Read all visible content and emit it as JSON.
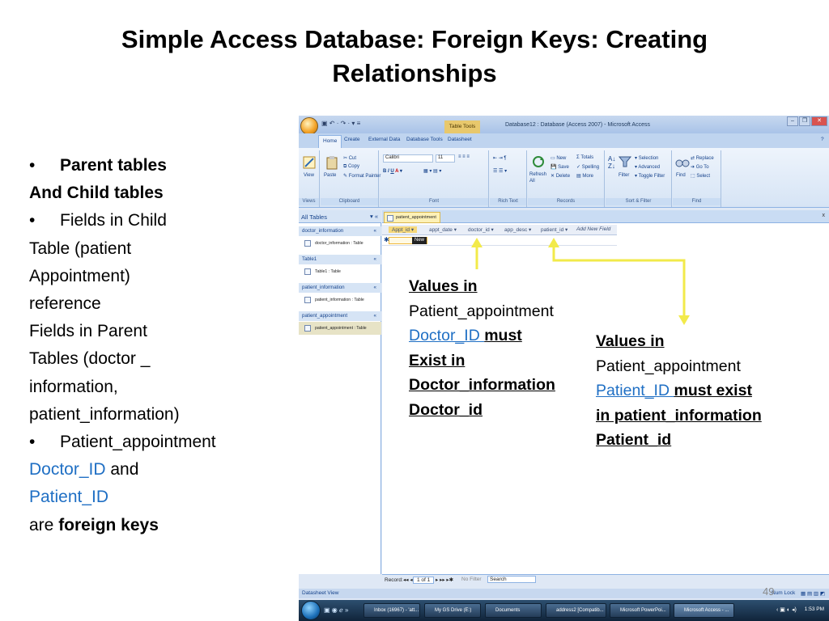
{
  "slide": {
    "title": "Simple Access Database: Foreign Keys: Creating Relationships",
    "left": {
      "bullet1_bold": "Parent tables",
      "line1b_bold": "And Child tables",
      "bullet2": "Fields in Child",
      "line2b": "Table (patient",
      "line2c": "Appointment)",
      "line2d": "reference",
      "line2e": "Fields in Parent",
      "line2f": "Tables (doctor _",
      "line2g": "information,",
      "line2h": "patient_information)",
      "bullet3": "Patient_appointment",
      "doctor_id": "Doctor_ID",
      "and": " and",
      "patient_id": "Patient_ID",
      "are": "are ",
      "foreign_keys": "foreign keys"
    },
    "note1": {
      "heading": "Values in",
      "line2": "Patient_appointment",
      "link": "Doctor_ID ",
      "must": " must",
      "line4": "Exist in",
      "line5": "Doctor_information",
      "line6": "Doctor_id"
    },
    "note2": {
      "heading": "Values in",
      "line2": "Patient_appointment",
      "link": "Patient_ID ",
      "must": " must exist",
      "line4": "in patient_information",
      "line5": "Patient_id"
    },
    "page_number": "49"
  },
  "access": {
    "window_title": "Database12 : Database (Access 2007) - Microsoft Access",
    "context_tab": "Table Tools",
    "tabs": [
      "Home",
      "Create",
      "External Data",
      "Database Tools",
      "Datasheet"
    ],
    "ribbon": {
      "views": {
        "view": "View",
        "label": "Views"
      },
      "clipboard": {
        "paste": "Paste",
        "cut": "Cut",
        "copy": "Copy",
        "format_painter": "Format Painter",
        "label": "Clipboard"
      },
      "font": {
        "family": "Calibri",
        "size": "11",
        "label": "Font"
      },
      "rich_text": {
        "label": "Rich Text"
      },
      "records": {
        "refresh": "Refresh All",
        "new": "New",
        "save": "Save",
        "delete": "Delete",
        "totals": "Totals",
        "spelling": "Spelling",
        "more": "More",
        "label": "Records"
      },
      "sort_filter": {
        "filter": "Filter",
        "selection": "Selection",
        "advanced": "Advanced",
        "toggle_filter": "Toggle Filter",
        "label": "Sort & Filter"
      },
      "find": {
        "find": "Find",
        "replace": "Replace",
        "goto": "Go To",
        "select": "Select",
        "label": "Find"
      }
    },
    "nav": {
      "header": "All Tables",
      "groups": [
        {
          "name": "doctor_information",
          "item": "doctor_information : Table"
        },
        {
          "name": "Table1",
          "item": "Table1 : Table"
        },
        {
          "name": "patient_information",
          "item": "patient_information : Table"
        },
        {
          "name": "patient_appointment",
          "item": "patient_appointment : Table"
        }
      ]
    },
    "doc_tab": "patient_appointment",
    "columns": [
      "Appt_id",
      "appt_date",
      "doctor_id",
      "app_desc",
      "patient_id",
      "Add New Field"
    ],
    "new_row": "New",
    "record_nav": {
      "label": "Record:",
      "position": "1 of 1",
      "filter": "No Filter",
      "search": "Search"
    },
    "status": {
      "left": "Datasheet View",
      "right": "Num Lock"
    },
    "taskbar": {
      "items": [
        "Inbox (16967) - 'att...",
        "My GS Drive (E:)",
        "Documents",
        "address2 [Compatib...",
        "Microsoft PowerPoi...",
        "Microsoft Access - ..."
      ],
      "clock": "1:53 PM"
    }
  },
  "colors": {
    "link_blue": "#1f6fc4",
    "arrow_yellow": "#f2ea4a"
  }
}
